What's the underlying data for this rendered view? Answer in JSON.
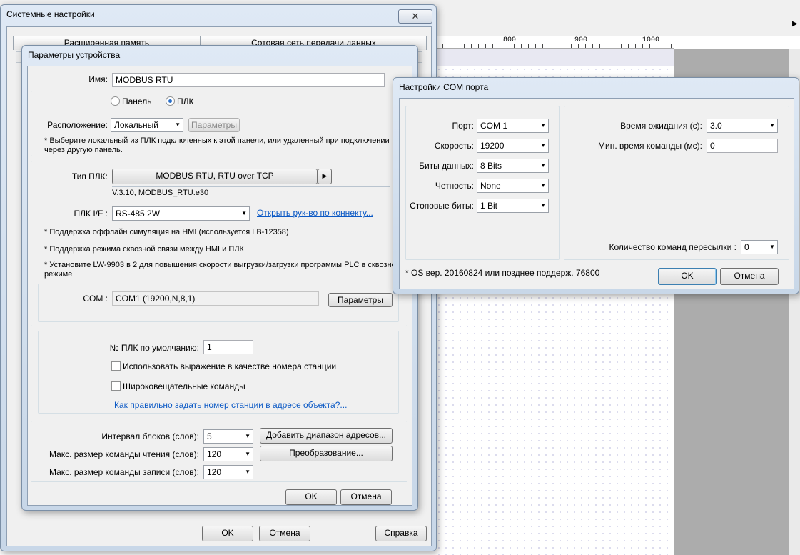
{
  "background": {
    "ruler_labels": [
      "800",
      "900",
      "1000"
    ]
  },
  "system_settings": {
    "title": "Системные настройки",
    "close_glyph": "✕",
    "tabs": [
      "Расширенная память",
      "Сотовая сеть передачи данных"
    ],
    "buttons": {
      "ok": "OK",
      "cancel": "Отмена",
      "help": "Справка"
    }
  },
  "device_params": {
    "title": "Параметры устройства",
    "name_label": "Имя:",
    "name_value": "MODBUS RTU",
    "radio_panel": "Панель",
    "radio_plc": "ПЛК",
    "location_label": "Расположение:",
    "location_value": "Локальный",
    "location_params_button": "Параметры",
    "location_note": "* Выберите локальный из ПЛК подключенных к этой панели, или удаленный при подключении через другую панель.",
    "plc_type_label": "Тип ПЛК:",
    "plc_type_value": "MODBUS RTU, RTU over TCP",
    "plc_type_arrow": "▶",
    "version": "V.3.10, MODBUS_RTU.e30",
    "plc_if_label": "ПЛК I/F :",
    "plc_if_value": "RS-485 2W",
    "open_manual_link": "Открыть рук-во по коннекту...",
    "notes": [
      "* Поддержка оффлайн симуляция на HMI (используется LB-12358)",
      "* Поддержка режима сквозной связи между HMI и ПЛК",
      "* Установите LW-9903 в 2 для повышения скорости выгрузки/загрузки программы PLC в сквозном режиме"
    ],
    "com_label": "COM :",
    "com_value": "COM1 (19200,N,8,1)",
    "com_params_button": "Параметры",
    "default_plc_label": "№ ПЛК по умолчанию:",
    "default_plc_value": "1",
    "use_expr_label": "Использовать выражение в качестве номера станции",
    "broadcast_label": "Широковещательные команды",
    "station_link": "Как правильно задать номер станции в адресе объекта?...",
    "block_interval_label": "Интервал блоков (слов):",
    "block_interval_value": "5",
    "max_read_label": "Макс. размер команды чтения (слов):",
    "max_read_value": "120",
    "max_write_label": "Макс. размер команды записи (слов):",
    "max_write_value": "120",
    "add_range_button": "Добавить диапазон адресов...",
    "convert_button": "Преобразование...",
    "ok": "OK",
    "cancel": "Отмена"
  },
  "com_settings": {
    "title": "Настройки COM порта",
    "port_label": "Порт:",
    "port_value": "COM 1",
    "speed_label": "Скорость:",
    "speed_value": "19200",
    "data_bits_label": "Биты данных:",
    "data_bits_value": "8 Bits",
    "parity_label": "Четность:",
    "parity_value": "None",
    "stop_bits_label": "Стоповые биты:",
    "stop_bits_value": "1 Bit",
    "timeout_label": "Время ожидания (с):",
    "timeout_value": "3.0",
    "min_cmd_label": "Мин. время команды (мс):",
    "min_cmd_value": "0",
    "resend_label": "Количество команд пересылки :",
    "resend_value": "0",
    "os_note": "* OS вер. 20160824 или позднее поддерж. 76800",
    "ok": "OK",
    "cancel": "Отмена"
  }
}
